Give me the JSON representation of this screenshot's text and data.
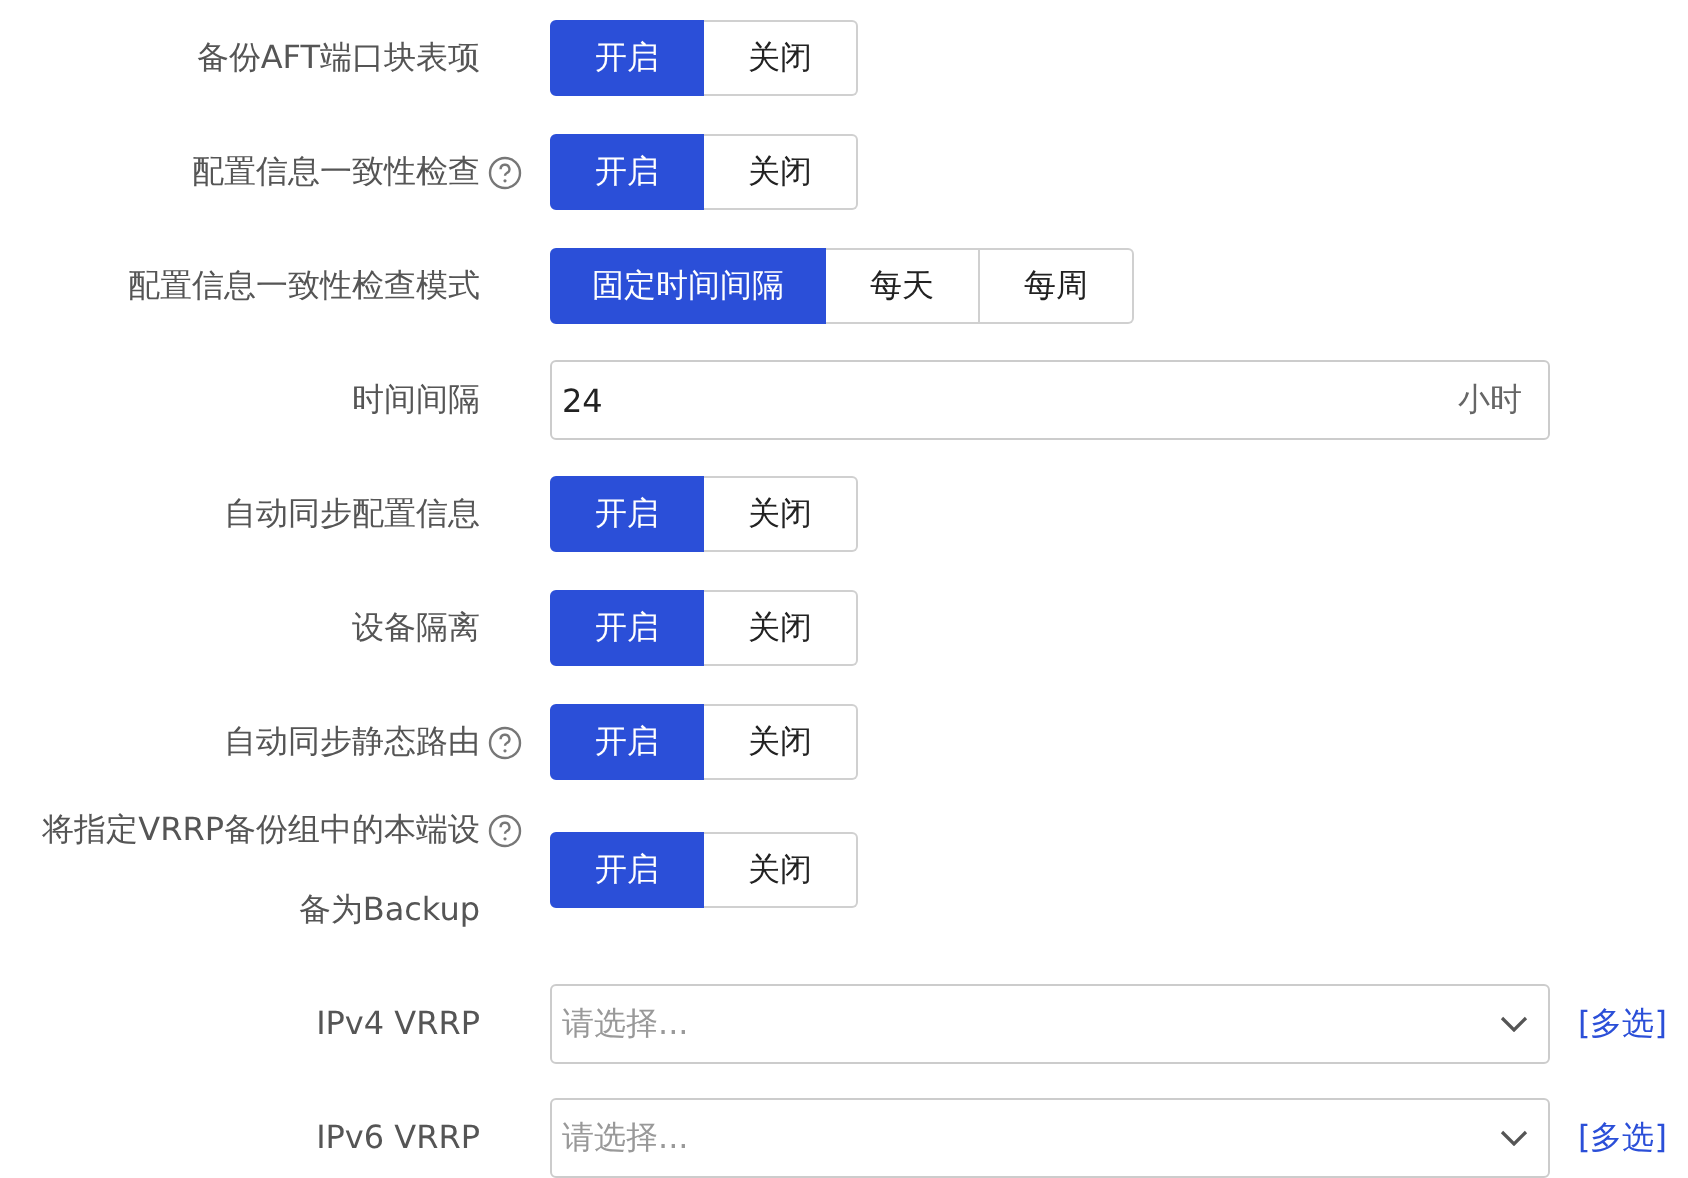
{
  "rows": [
    {
      "kind": "segmented",
      "label": "备份AFT端口块表项",
      "help": false,
      "options": [
        {
          "label": "开启",
          "selected": true
        },
        {
          "label": "关闭",
          "selected": false
        }
      ]
    },
    {
      "kind": "segmented",
      "label": "配置信息一致性检查",
      "help": true,
      "options": [
        {
          "label": "开启",
          "selected": true
        },
        {
          "label": "关闭",
          "selected": false
        }
      ]
    },
    {
      "kind": "segmented",
      "label": "配置信息一致性检查模式",
      "help": false,
      "options": [
        {
          "label": "固定时间间隔",
          "selected": true
        },
        {
          "label": "每天",
          "selected": false
        },
        {
          "label": "每周",
          "selected": false
        }
      ]
    },
    {
      "kind": "input",
      "label": "时间间隔",
      "help": false,
      "value": "24",
      "unit": "小时"
    },
    {
      "kind": "segmented",
      "label": "自动同步配置信息",
      "help": false,
      "options": [
        {
          "label": "开启",
          "selected": true
        },
        {
          "label": "关闭",
          "selected": false
        }
      ]
    },
    {
      "kind": "segmented",
      "label": "设备隔离",
      "help": false,
      "options": [
        {
          "label": "开启",
          "selected": true
        },
        {
          "label": "关闭",
          "selected": false
        }
      ]
    },
    {
      "kind": "segmented",
      "label": "自动同步静态路由",
      "help": true,
      "options": [
        {
          "label": "开启",
          "selected": true
        },
        {
          "label": "关闭",
          "selected": false
        }
      ]
    },
    {
      "kind": "segmented",
      "label": "将指定VRRP备份组中的本端设备为Backup",
      "help": true,
      "options": [
        {
          "label": "开启",
          "selected": true
        },
        {
          "label": "关闭",
          "selected": false
        }
      ]
    },
    {
      "kind": "select",
      "label": "IPv4 VRRP",
      "help": false,
      "placeholder": "请选择...",
      "link": "[多选]"
    },
    {
      "kind": "select",
      "label": "IPv6 VRRP",
      "help": false,
      "placeholder": "请选择...",
      "link": "[多选]"
    }
  ]
}
